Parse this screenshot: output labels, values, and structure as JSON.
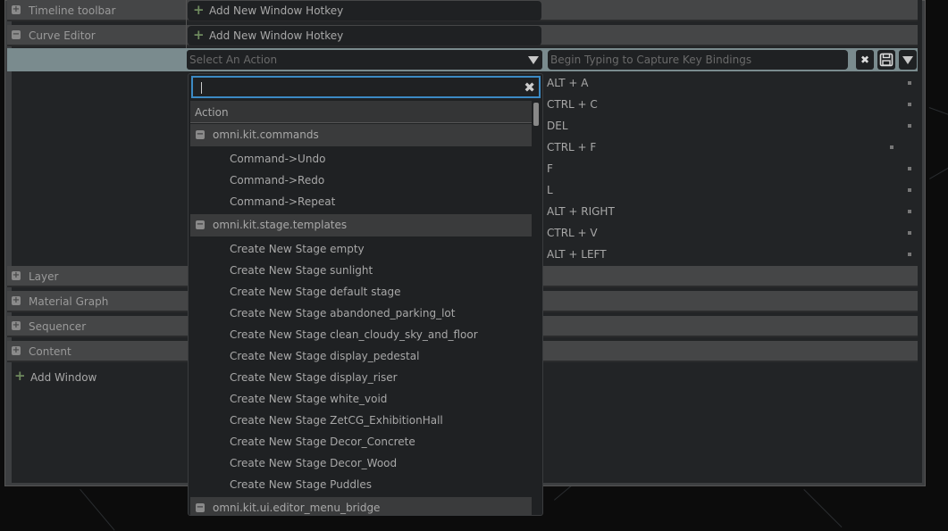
{
  "panel": {
    "rows_top": [
      {
        "label": "Timeline toolbar",
        "expanded": false
      },
      {
        "label": "Curve Editor",
        "expanded": true
      }
    ],
    "add_hotkey_label": "Add New Window Hotkey",
    "rows_bottom": [
      {
        "label": "Layer"
      },
      {
        "label": "Material Graph"
      },
      {
        "label": "Sequencer"
      },
      {
        "label": "Content"
      }
    ],
    "add_window_label": "Add Window"
  },
  "editor": {
    "select_placeholder": "Select An Action",
    "capture_placeholder": "Begin Typing to Capture Key Bindings",
    "icons": [
      "clear-icon",
      "save-icon",
      "dropdown-icon"
    ]
  },
  "key_bindings": [
    "ALT + A",
    "CTRL + C",
    "DEL",
    "CTRL + F",
    "F",
    "L",
    "ALT + RIGHT",
    "CTRL + V",
    "ALT + LEFT"
  ],
  "dropdown": {
    "search_value": "",
    "header": "Action",
    "groups": [
      {
        "name": "omni.kit.commands",
        "items": [
          "Command->Undo",
          "Command->Redo",
          "Command->Repeat"
        ]
      },
      {
        "name": "omni.kit.stage.templates",
        "items": [
          "Create New Stage empty",
          "Create New Stage sunlight",
          "Create New Stage default stage",
          "Create New Stage abandoned_parking_lot",
          "Create New Stage clean_cloudy_sky_and_floor",
          "Create New Stage display_pedestal",
          "Create New Stage display_riser",
          "Create New Stage white_void",
          "Create New Stage ZetCG_ExhibitionHall",
          "Create New Stage Decor_Concrete",
          "Create New Stage Decor_Wood",
          "Create New Stage Puddles"
        ]
      },
      {
        "name": "omni.kit.ui.editor_menu_bridge",
        "items": []
      }
    ]
  },
  "colors": {
    "selection_row": "#7a8b8e",
    "search_focus": "#3c8ac4",
    "plus_green": "#6e8a5e"
  }
}
